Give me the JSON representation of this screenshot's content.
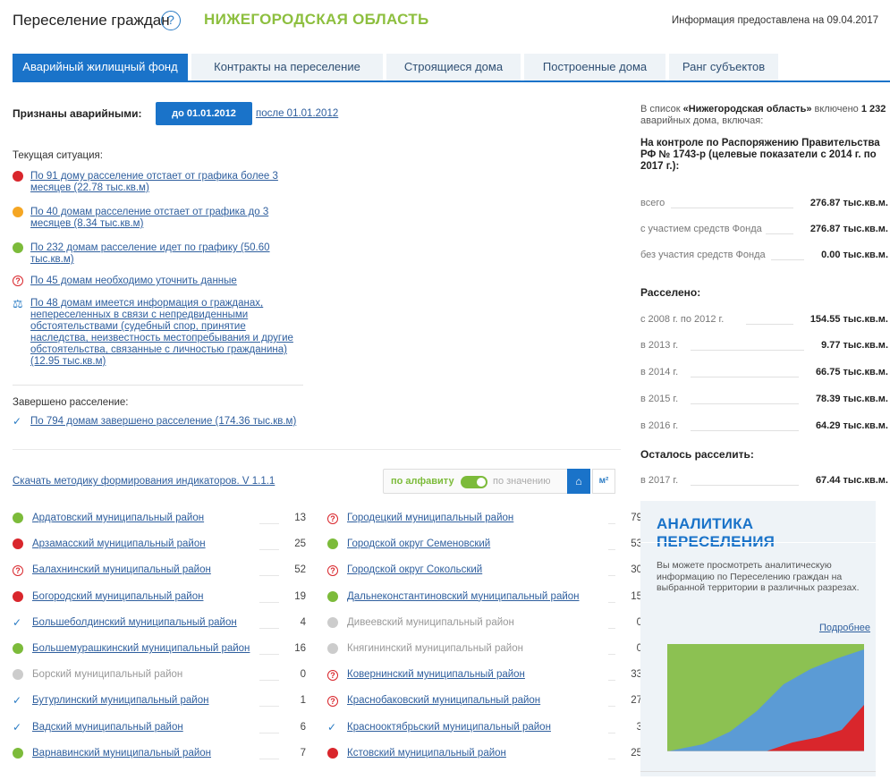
{
  "header": {
    "title": "Переселение граждан",
    "help_icon": "?",
    "region": "НИЖЕГОРОДСКАЯ ОБЛАСТЬ",
    "info_date": "Информация предоставлена на 09.04.2017"
  },
  "tabs": [
    {
      "label": "Аварийный жилищный фонд",
      "active": true
    },
    {
      "label": "Контракты на переселение",
      "active": false
    },
    {
      "label": "Строящиеся дома",
      "active": false
    },
    {
      "label": "Построенные дома",
      "active": false
    },
    {
      "label": "Ранг субъектов",
      "active": false
    }
  ],
  "recognized": {
    "label": "Признаны аварийными:",
    "before_btn": "до 01.01.2012",
    "after_link": "после 01.01.2012"
  },
  "current": {
    "label": "Текущая ситуация:",
    "items": [
      {
        "icon": "red-dot",
        "text": "По 91 дому расселение отстает от графика более 3 месяцев (22.78 тыс.кв.м)"
      },
      {
        "icon": "orange-dot",
        "text": "По 40 домам расселение отстает от графика до 3 месяцев (8.34 тыс.кв.м)"
      },
      {
        "icon": "green-dot",
        "text": "По 232 домам расселение идет по графику (50.60 тыс.кв.м)"
      },
      {
        "icon": "question-icon",
        "text": "По 45 домам необходимо уточнить данные"
      },
      {
        "icon": "scales-icon",
        "text": "По 48 домам имеется информация о гражданах, непереселенных в связи с непредвиденными обстоятельствами (судебный спор, принятие наследства, неизвестность местопребывания и другие обстоятельства, связанные с личностью гражданина) (12.95 тыс.кв.м)"
      }
    ]
  },
  "completed": {
    "label": "Завершено расселение:",
    "text": "По 794 домам завершено расселение (174.36 тыс.кв.м)"
  },
  "method_link": "Скачать методику формирования индикаторов. V 1.1.1",
  "sort": {
    "alpha": "по алфавиту",
    "value": "по значению",
    "home_icon": "⌂",
    "m2": "м²"
  },
  "municipalities_left": [
    {
      "icon": "green",
      "name": "Ардатовский муниципальный район",
      "count": "13"
    },
    {
      "icon": "red",
      "name": "Арзамасский муниципальный район",
      "count": "25"
    },
    {
      "icon": "question",
      "name": "Балахнинский муниципальный район",
      "count": "52"
    },
    {
      "icon": "red",
      "name": "Богородский муниципальный район",
      "count": "19"
    },
    {
      "icon": "check",
      "name": "Большеболдинский муниципальный район",
      "count": "4"
    },
    {
      "icon": "green",
      "name": "Большемурашкинский муниципальный район",
      "count": "16"
    },
    {
      "icon": "gray",
      "name": "Борский муниципальный район",
      "count": "0"
    },
    {
      "icon": "check",
      "name": "Бутурлинский муниципальный район",
      "count": "1"
    },
    {
      "icon": "check",
      "name": "Вадский муниципальный район",
      "count": "6"
    },
    {
      "icon": "green",
      "name": "Варнавинский муниципальный район",
      "count": "7"
    }
  ],
  "municipalities_right": [
    {
      "icon": "question",
      "name": "Городецкий муниципальный район",
      "count": "79"
    },
    {
      "icon": "green",
      "name": "Городской округ Семеновский",
      "count": "53"
    },
    {
      "icon": "question",
      "name": "Городской округ Сокольский",
      "count": "30"
    },
    {
      "icon": "green",
      "name": "Дальнеконстантиновский муниципальный район",
      "count": "15"
    },
    {
      "icon": "gray",
      "name": "Дивеевский муниципальный район",
      "count": "0"
    },
    {
      "icon": "gray",
      "name": "Княгининский муниципальный район",
      "count": "0"
    },
    {
      "icon": "question",
      "name": "Ковернинский муниципальный район",
      "count": "33"
    },
    {
      "icon": "question",
      "name": "Краснобаковский муниципальный район",
      "count": "27"
    },
    {
      "icon": "check",
      "name": "Краснооктябрьский муниципальный район",
      "count": "3"
    },
    {
      "icon": "red",
      "name": "Кстовский муниципальный район",
      "count": "25"
    }
  ],
  "right_panel": {
    "intro_prefix": "В список",
    "intro_region": "«Нижегородская область»",
    "intro_mid": "включено",
    "intro_count": "1 232",
    "intro_suffix": "аварийных дома, включая:",
    "control_title": "На контроле по Распоряжению Правительства РФ № 1743-р (целевые показатели с 2014 г. по 2017 г.):",
    "control_rows": [
      {
        "label": "всего",
        "value": "276.87 тыс.кв.м."
      },
      {
        "label": "с участием средств Фонда",
        "value": "276.87 тыс.кв.м."
      },
      {
        "label": "без участия средств Фонда",
        "value": "0.00 тыс.кв.м."
      }
    ],
    "resettled_title": "Расселено:",
    "resettled_rows": [
      {
        "label": "с 2008 г. по 2012 г.",
        "value": "154.55 тыс.кв.м."
      },
      {
        "label": "в 2013 г.",
        "value": "9.77 тыс.кв.м."
      },
      {
        "label": "в 2014 г.",
        "value": "66.75 тыс.кв.м."
      },
      {
        "label": "в 2015 г.",
        "value": "78.39 тыс.кв.м."
      },
      {
        "label": "в 2016 г.",
        "value": "64.29 тыс.кв.м."
      }
    ],
    "remaining_title": "Осталось расселить:",
    "remaining_rows": [
      {
        "label": "в 2017 г.",
        "value": "67.44 тыс.кв.м."
      }
    ]
  },
  "analytics": {
    "title": "АНАЛИТИКА ПЕРЕСЕЛЕНИЯ",
    "text": "Вы можете просмотреть аналитическую информацию по Переселению граждан на выбранной территории в различных разрезах.",
    "more": "Подробнее"
  },
  "colors": {
    "accent": "#1a73c9",
    "region": "#8dbf3f",
    "red": "#d9262c",
    "orange": "#f5a623",
    "green": "#7cbb3a",
    "chart_green": "#8cc152",
    "chart_blue": "#5b9bd5",
    "chart_red": "#d9262c"
  }
}
